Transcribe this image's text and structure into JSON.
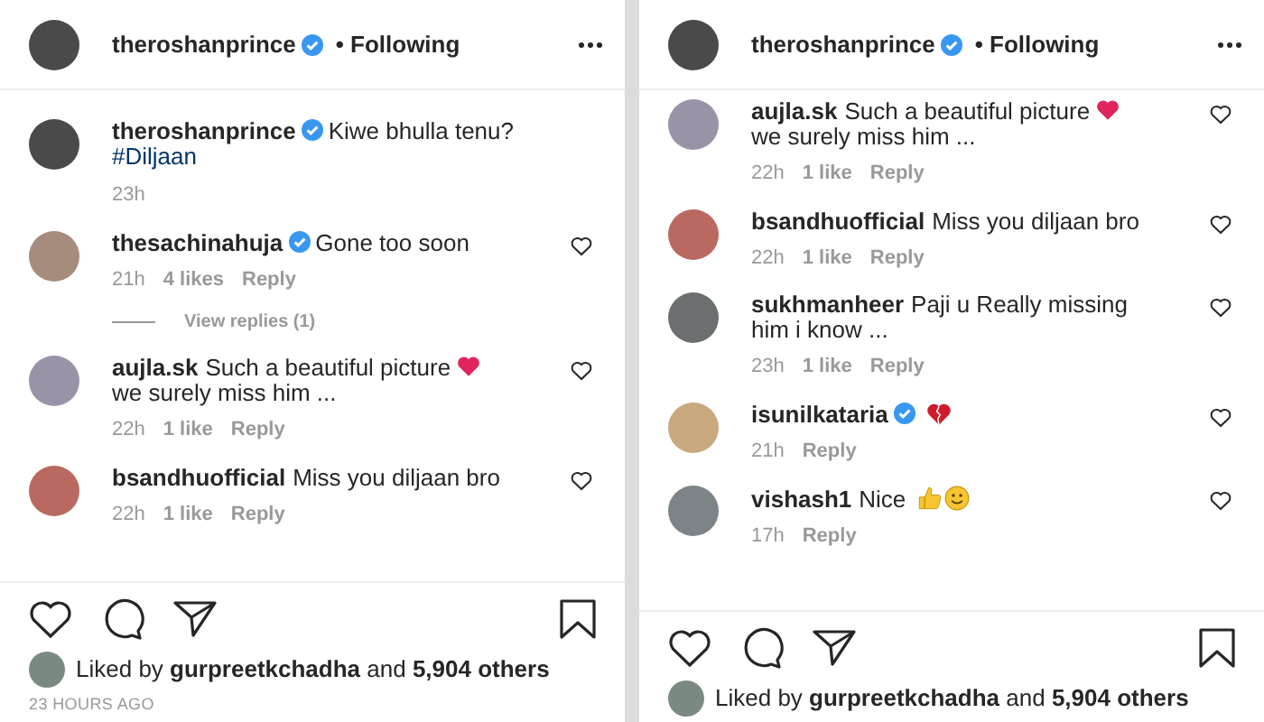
{
  "panels": [
    {
      "header": {
        "username": "theroshanprince",
        "verified": true,
        "following": "• Following"
      },
      "caption": {
        "username": "theroshanprince",
        "verified": true,
        "parts": [
          {
            "kind": "text",
            "text": "Kiwe bhulla tenu?"
          },
          {
            "kind": "hashtag",
            "text": "#Diljaan"
          }
        ],
        "time": "23h"
      },
      "comments": [
        {
          "username": "thesachinahuja",
          "verified": true,
          "parts": [
            {
              "kind": "text",
              "text": "Gone too soon"
            }
          ],
          "time": "21h",
          "likes": "4 likes",
          "reply": "Reply",
          "view_replies": "View replies (1)"
        },
        {
          "username": "aujla.sk",
          "verified": false,
          "parts": [
            {
              "kind": "text",
              "text": "Such a beautiful picture"
            },
            {
              "kind": "heart"
            },
            {
              "kind": "text",
              "text": "we surely miss him ..."
            }
          ],
          "time": "22h",
          "likes": "1 like",
          "reply": "Reply"
        },
        {
          "username": "bsandhuofficial",
          "verified": false,
          "parts": [
            {
              "kind": "text",
              "text": "Miss you diljaan bro"
            }
          ],
          "time": "22h",
          "likes": "1 like",
          "reply": "Reply"
        }
      ],
      "liked_by": "Liked by **gurpreetkchadha** and **5,904 others**",
      "posted": "23 HOURS AGO"
    },
    {
      "header": {
        "username": "theroshanprince",
        "verified": true,
        "following": "• Following"
      },
      "comments": [
        {
          "username": "aujla.sk",
          "verified": false,
          "parts": [
            {
              "kind": "text",
              "text": "Such a beautiful picture"
            },
            {
              "kind": "heart"
            },
            {
              "kind": "text",
              "text": "we surely miss him ..."
            }
          ],
          "time": "22h",
          "likes": "1 like",
          "reply": "Reply"
        },
        {
          "username": "bsandhuofficial",
          "verified": false,
          "parts": [
            {
              "kind": "text",
              "text": "Miss you diljaan bro"
            }
          ],
          "time": "22h",
          "likes": "1 like",
          "reply": "Reply"
        },
        {
          "username": "sukhmanheer",
          "verified": false,
          "parts": [
            {
              "kind": "text",
              "text": "Paji u Really missing him i know ..."
            }
          ],
          "time": "23h",
          "likes": "1 like",
          "reply": "Reply"
        },
        {
          "username": "isunilkataria",
          "verified": true,
          "parts": [
            {
              "kind": "broken-heart"
            }
          ],
          "time": "21h",
          "reply": "Reply"
        },
        {
          "username": "vishash1",
          "verified": false,
          "parts": [
            {
              "kind": "text",
              "text": "Nice"
            },
            {
              "kind": "thumbs-up"
            },
            {
              "kind": "smile"
            }
          ],
          "time": "17h",
          "reply": "Reply"
        }
      ],
      "liked_by": "Liked by **gurpreetkchadha** and **5,904 others**"
    }
  ]
}
